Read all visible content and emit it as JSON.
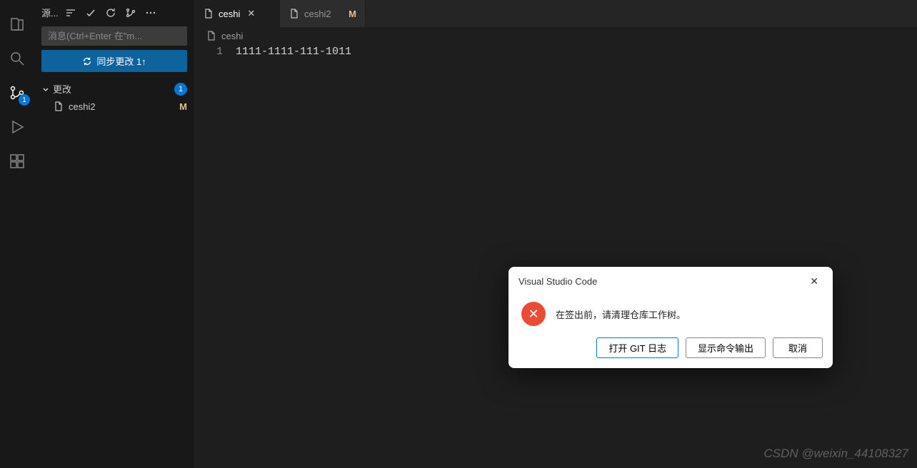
{
  "activity": {
    "scm_badge": "1"
  },
  "sidebar": {
    "title": "源...",
    "commit_placeholder": "消息(Ctrl+Enter 在\"m...",
    "sync_label": "同步更改 1↑",
    "changes_section": "更改",
    "changes_count": "1",
    "files": [
      {
        "name": "ceshi2",
        "status": "M"
      }
    ]
  },
  "tabs": [
    {
      "name": "ceshi",
      "active": true,
      "closable": true
    },
    {
      "name": "ceshi2",
      "active": false,
      "modified": "M"
    }
  ],
  "breadcrumb": "ceshi",
  "editor": {
    "line_number": "1",
    "content": "1111-1111-111-1011"
  },
  "dialog": {
    "title": "Visual Studio Code",
    "message": "在签出前，请清理仓库工作树。",
    "btn_git_log": "打开 GIT 日志",
    "btn_output": "显示命令输出",
    "btn_cancel": "取消"
  },
  "watermark": "CSDN @weixin_44108327"
}
